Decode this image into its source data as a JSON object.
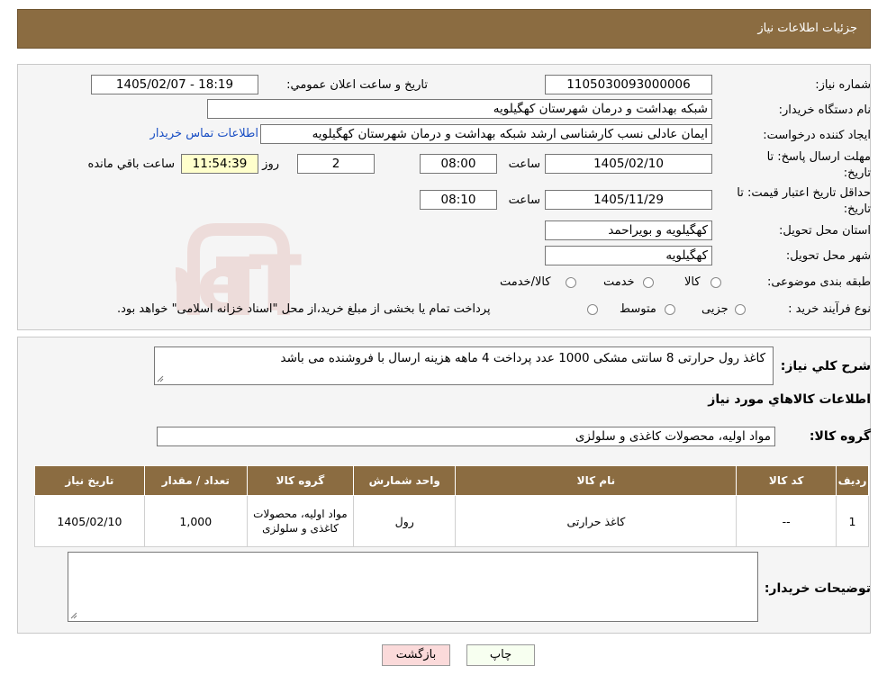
{
  "header": {
    "title": "جزئیات اطلاعات نیاز"
  },
  "need": {
    "number_label": "شماره نیاز:",
    "number_value": "1105030093000006",
    "announce_label": "تاریخ و ساعت اعلان عمومي:",
    "announce_value": "1405/02/07 - 18:19",
    "buyer_label": "نام دستگاه خريدار:",
    "buyer_value": "شبکه بهداشت و درمان شهرستان کهگیلویه",
    "creator_label": "ايجاد کننده درخواست:",
    "creator_value": "ایمان عادلی نسب کارشناسی ارشد شبکه بهداشت و درمان شهرستان کهگیلویه",
    "contact_link": "اطلاعات تماس خريدار",
    "deadline_label_1": "مهلت ارسال پاسخ: تا",
    "deadline_label_2": "تاریخ:",
    "deadline_date": "1405/02/10",
    "time_label": "ساعت",
    "deadline_time": "08:00",
    "days_value": "2",
    "days_label": "روز و",
    "remaining_time": "11:54:39",
    "remaining_label": "ساعت باقي مانده",
    "validity_label_1": "حداقل تاريخ اعتبار قيمت: تا",
    "validity_label_2": "تاريخ:",
    "validity_date": "1405/11/29",
    "validity_time": "08:10",
    "province_label": "استان محل تحويل:",
    "province_value": "کهگیلویه و بویراحمد",
    "city_label": "شهر محل تحويل:",
    "city_value": "کهگیلویه",
    "category_label": "طبقه بندی موضوعی:",
    "category_options": [
      "کالا",
      "خدمت",
      "کالا/خدمت"
    ],
    "process_label": "نوع فرآيند خريد :",
    "process_options": [
      "جزیی",
      "متوسط"
    ],
    "process_note": "پرداخت تمام يا بخشی از مبلغ خريد،از محل \"اسناد خزانه اسلامی\" خواهد بود."
  },
  "description": {
    "label": "شرح كلي نياز:",
    "value": "کاغذ رول حرارتی 8 سانتی مشکی 1000 عدد پرداخت 4 ماهه هزینه ارسال با فروشنده  می باشد",
    "items_title": "اطلاعات كالاهاي مورد نياز",
    "group_label": "گروه کالا:",
    "group_value": "مواد اولیه، محصولات کاغذی و سلولزی"
  },
  "table": {
    "headers": [
      "رديف",
      "کد کالا",
      "نام کالا",
      "واحد شمارش",
      "گروه کالا",
      "تعداد / مقدار",
      "تاریخ نیاز"
    ],
    "rows": [
      {
        "row": "1",
        "code": "--",
        "name": "کاغذ حرارتی",
        "unit": "رول",
        "group": "مواد اولیه، محصولات کاغذی و سلولزی",
        "qty": "1,000",
        "date": "1405/02/10"
      }
    ]
  },
  "notes": {
    "label": "توضيحات خريدار:"
  },
  "buttons": {
    "print": "چاپ",
    "back": "بازگشت"
  },
  "watermark": {
    "text": "AriaTender.neT"
  },
  "colors": {
    "header": "#8b6c41",
    "link": "#1a4fc4",
    "back_button": "#fbdada"
  }
}
